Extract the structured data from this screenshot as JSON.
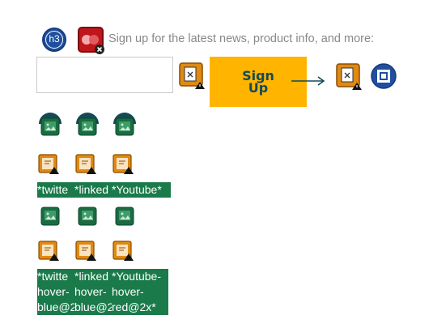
{
  "signup": {
    "tagline": "Sign up for the latest news, product info, and more:",
    "email_placeholder": "",
    "email_value": "",
    "button_line1": "Sign",
    "button_line2": "Up",
    "badge_text": "h3"
  },
  "social": {
    "row1_labels": [
      "*twitte",
      "*linked",
      "*Youtube*"
    ],
    "row2_labels": [
      [
        "*twitte",
        "hover-",
        "blue@2"
      ],
      [
        "*linked",
        "hover-",
        "blue@2"
      ],
      [
        "*Youtube-",
        "hover-",
        "red@2x*"
      ]
    ]
  },
  "colors": {
    "accent": "#ffb400",
    "button_text": "#124a57",
    "label_bg": "#1a7a4a",
    "dark_blue": "#1f4f9e"
  },
  "icons": {
    "badge": "h3-badge-icon",
    "plugin": "missing-plugin-icon",
    "broken": "broken-image-icon",
    "arrow": "arrow-right-icon",
    "stop": "stop-square-icon",
    "image": "image-placeholder-icon"
  }
}
